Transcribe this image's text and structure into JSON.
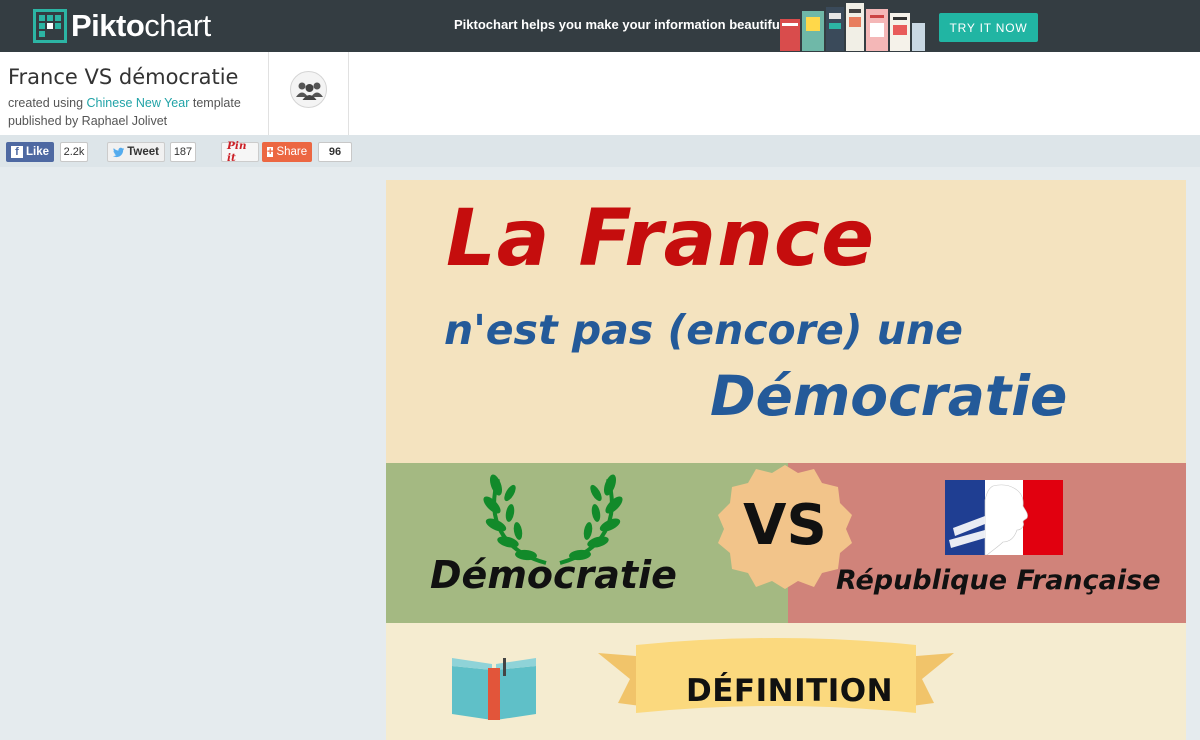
{
  "topbar": {
    "logo_text_bold": "Pikto",
    "logo_text_light": "chart",
    "tagline": "Piktochart helps you make your information beautiful",
    "cta_label": "TRY IT NOW"
  },
  "header": {
    "title": "France VS démocratie",
    "created_prefix": "created using ",
    "template_link": "Chinese New Year",
    "created_suffix": " template",
    "published": "published by Raphael Jolivet"
  },
  "share": {
    "facebook_label": "Like",
    "facebook_count": "2.2k",
    "twitter_label": "Tweet",
    "twitter_count": "187",
    "pinterest_label": "Pin it",
    "share_label": "Share",
    "share_count": "96"
  },
  "infographic": {
    "headline_1": "La France",
    "headline_2": "n'est pas (encore) une",
    "headline_3": "Démocratie",
    "left_label": "Démocratie",
    "vs_label": "VS",
    "right_label": "République Française",
    "section_label": "DÉFINITION"
  },
  "colors": {
    "topbar": "#343d42",
    "accent": "#21b5a3",
    "headline_red": "#c50d0d",
    "headline_blue": "#245a99",
    "hero_bg": "#f4e3bf",
    "left_panel": "#a4b982",
    "right_panel": "#d0837a"
  }
}
